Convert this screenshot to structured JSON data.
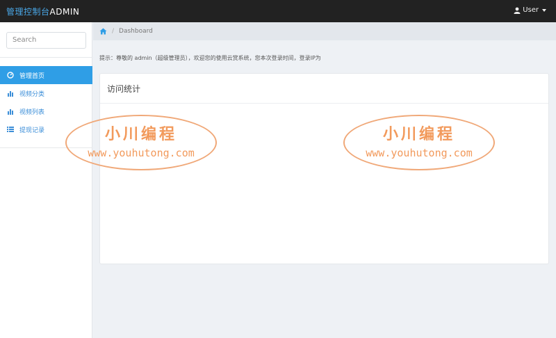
{
  "header": {
    "brand_cn": "管理控制台",
    "brand_en": "ADMIN",
    "user_label": "User",
    "icons": {
      "user": "user-icon",
      "caret": "caret-down-icon"
    },
    "colors": {
      "bar": "#222222",
      "brand_cn": "#4aa8e8"
    }
  },
  "sidebar": {
    "search_placeholder": "Search",
    "items": [
      {
        "label": "管理首页",
        "icon": "dashboard-icon",
        "active": true
      },
      {
        "label": "视频分类",
        "icon": "bar-chart-icon",
        "active": false
      },
      {
        "label": "视频列表",
        "icon": "bar-chart-icon",
        "active": false
      },
      {
        "label": "提现记录",
        "icon": "list-icon",
        "active": false
      }
    ],
    "colors": {
      "active_bg": "#2f9ee6",
      "link": "#3b8ed8"
    }
  },
  "breadcrumb": {
    "home_icon": "home-icon",
    "current": "Dashboard"
  },
  "notice": "提示：尊敬的 admin（超级管理员），欢迎您的使用云赏系统，您本次登录时间，登录IP为",
  "panel": {
    "title": "访问统计"
  },
  "watermarks": [
    {
      "title": "小川编程",
      "url": "www.youhutong.com"
    },
    {
      "title": "小川编程",
      "url": "www.youhutong.com"
    }
  ]
}
